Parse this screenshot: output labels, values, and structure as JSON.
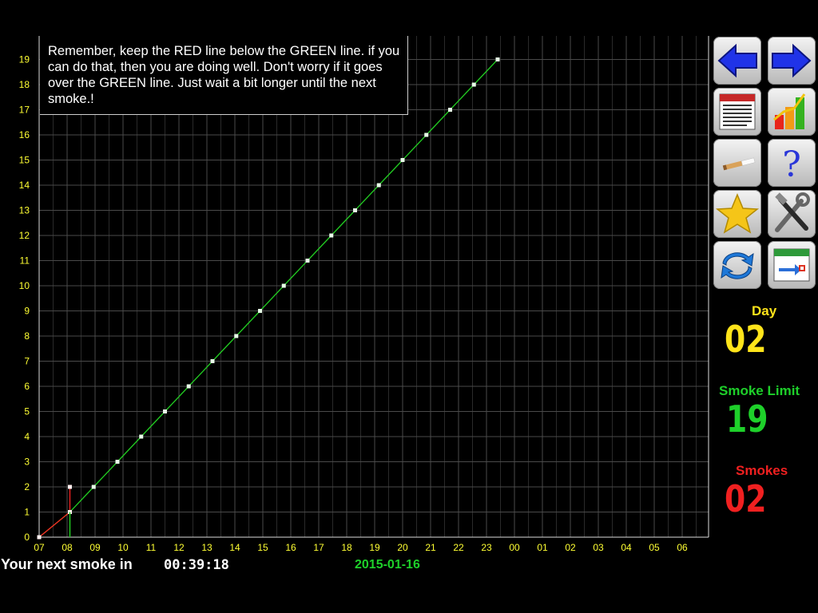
{
  "note": {
    "text": "Remember, keep the RED line below the GREEN line. if you can do that, then you are doing well. Don't worry if it goes over the GREEN line. Just wait a bit longer until the next smoke.!"
  },
  "toolbar": {
    "icons": [
      "back-arrow-icon",
      "forward-arrow-icon",
      "calendar-icon",
      "bar-chart-icon",
      "cigarette-icon",
      "help-icon",
      "favorite-star-icon",
      "tools-icon",
      "refresh-icon",
      "schedule-icon"
    ]
  },
  "stats": {
    "day_label": "Day",
    "day_value": "02",
    "limit_label": "Smoke Limit",
    "limit_value": "19",
    "smokes_label": "Smokes",
    "smokes_value": "02"
  },
  "footer": {
    "next_smoke_label": "Your next smoke in",
    "countdown": "00:39:18",
    "date": "2015-01-16"
  },
  "chart_data": {
    "type": "line",
    "x_ticks": [
      "07",
      "08",
      "09",
      "10",
      "11",
      "12",
      "13",
      "14",
      "15",
      "16",
      "17",
      "18",
      "19",
      "20",
      "21",
      "22",
      "23",
      "00",
      "01",
      "02",
      "03",
      "04",
      "05",
      "06"
    ],
    "y_ticks": [
      0,
      1,
      2,
      3,
      4,
      5,
      6,
      7,
      8,
      9,
      10,
      11,
      12,
      13,
      14,
      15,
      16,
      17,
      18,
      19
    ],
    "ylim": [
      0,
      19.9
    ],
    "series": [
      {
        "color": "#22cc22",
        "points": [
          [
            0,
            0
          ],
          [
            1.1,
            1
          ],
          [
            1.95,
            2
          ],
          [
            2.8,
            3
          ],
          [
            3.65,
            4
          ],
          [
            4.5,
            5
          ],
          [
            5.35,
            6
          ],
          [
            6.2,
            7
          ],
          [
            7.05,
            8
          ],
          [
            7.9,
            9
          ],
          [
            8.75,
            10
          ],
          [
            9.6,
            11
          ],
          [
            10.45,
            12
          ],
          [
            11.3,
            13
          ],
          [
            12.15,
            14
          ],
          [
            13,
            15
          ],
          [
            13.85,
            16
          ],
          [
            14.7,
            17
          ],
          [
            15.55,
            18
          ],
          [
            16.4,
            19
          ]
        ]
      },
      {
        "color": "#ff2222",
        "points": [
          [
            0,
            0
          ],
          [
            1.1,
            1
          ],
          [
            1.1,
            2
          ]
        ]
      }
    ],
    "grid": true,
    "colors": {
      "ticks": "#ffff33",
      "grid": "#4a4a4a",
      "limit": "#22cc22",
      "smokes": "#ff2222"
    }
  }
}
